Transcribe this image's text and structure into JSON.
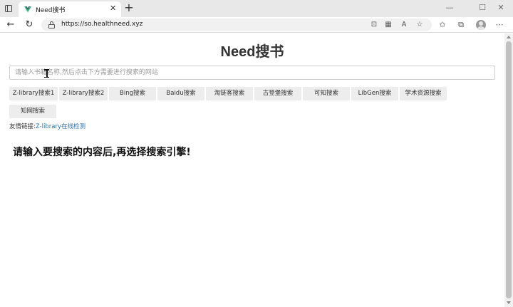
{
  "browser": {
    "tab_title": "Need搜书",
    "tab_close_glyph": "✕",
    "new_tab_glyph": "+",
    "url": "https://so.healthneed.xyz",
    "accent_color": "#2d6fb3"
  },
  "page": {
    "title": "Need搜书",
    "search": {
      "placeholder": "请输入书籍名称,然后点击下方需要进行搜索的网站",
      "value": ""
    },
    "engines": [
      {
        "label": "Z-library搜索1"
      },
      {
        "label": "Z-library搜索2"
      },
      {
        "label": "Bing搜索"
      },
      {
        "label": "Baidu搜索"
      },
      {
        "label": "淘链客搜索"
      },
      {
        "label": "古登堡搜索"
      },
      {
        "label": "可知搜索"
      },
      {
        "label": "LibGen搜索"
      },
      {
        "label": "学术资源搜索"
      },
      {
        "label": "知网搜索"
      }
    ],
    "friend_links": {
      "prefix": "友情链接:",
      "link_text": "Z-library在线检测"
    },
    "hint": "请输入要搜索的内容后,再选择搜索引擎!"
  }
}
